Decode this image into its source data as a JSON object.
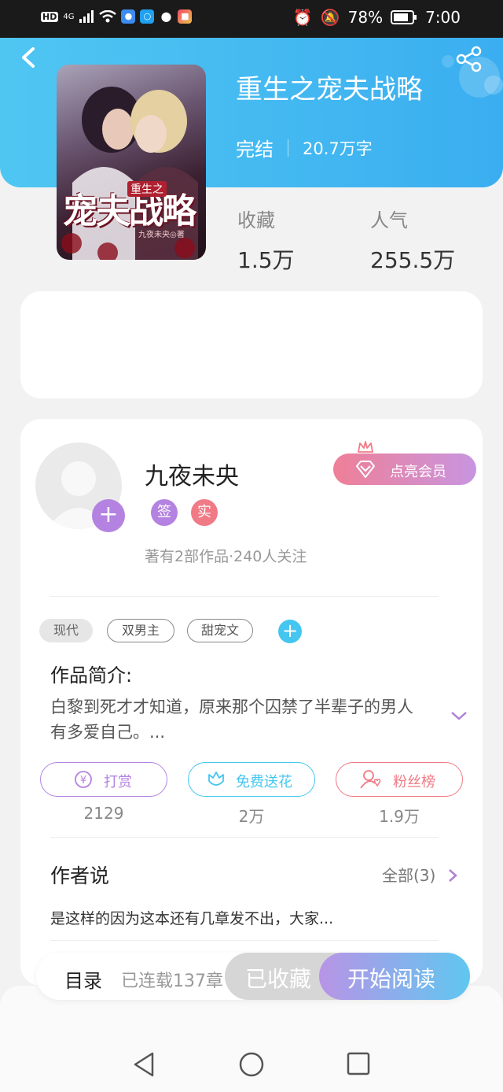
{
  "status_bar": {
    "hd": "HD",
    "network": "4G",
    "battery_percent": "78%",
    "time": "7:00"
  },
  "book": {
    "title": "重生之宠夫战略",
    "status": "完结",
    "word_count": "20.7万字",
    "cover": {
      "art_subtitle": "重生之",
      "art_title": "宠夫战略",
      "art_author": "九夜未央◎著"
    },
    "stats": [
      {
        "label": "收藏",
        "value": "1.5万"
      },
      {
        "label": "人气",
        "value": "255.5万"
      }
    ]
  },
  "author": {
    "name": "九夜未央",
    "badges": [
      {
        "text": "签",
        "color": "#b482e0"
      },
      {
        "text": "实",
        "color": "#f07a85"
      }
    ],
    "summary": "著有2部作品·240人关注",
    "vip_button": "点亮会员"
  },
  "tags": [
    {
      "label": "现代",
      "style": "fill"
    },
    {
      "label": "双男主",
      "style": "outline"
    },
    {
      "label": "甜宠文",
      "style": "outline"
    }
  ],
  "intro": {
    "title": "作品简介:",
    "text": "白黎到死才才知道，原来那个囚禁了半辈子的男人有多爱自己。..."
  },
  "actions": [
    {
      "label": "打赏",
      "count": "2129",
      "color": "#b482e0"
    },
    {
      "label": "免费送花",
      "count": "2万",
      "color": "#45c6f0"
    },
    {
      "label": "粉丝榜",
      "count": "1.9万",
      "color": "#f07a85"
    }
  ],
  "author_says": {
    "title": "作者说",
    "all_link": "全部(3)",
    "preview": "是这样的因为这本还有几章发不出，大家..."
  },
  "bottom": {
    "toc": "目录",
    "serial": "已连载137章",
    "favorited": "已收藏",
    "start_reading": "开始阅读"
  },
  "colors": {
    "header_start": "#4fc6f2",
    "header_end": "#3aaef0",
    "purple": "#b482e0",
    "pink": "#f07a85",
    "cyan": "#45c6f0"
  }
}
